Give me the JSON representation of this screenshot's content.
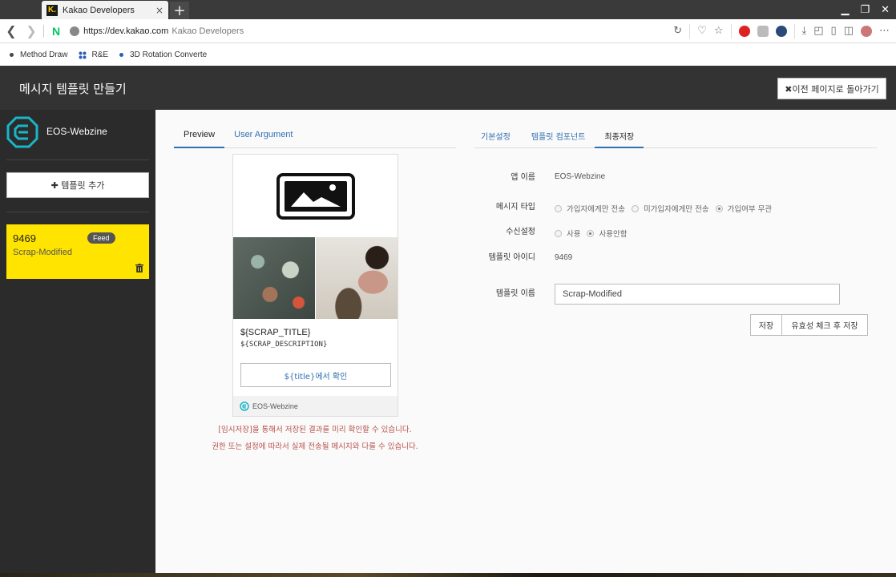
{
  "browser": {
    "tab_favicon": "K.",
    "tab_title": "Kakao Developers",
    "tab_close": "×",
    "new_tab": "+",
    "naver_logo": "N",
    "url": "https://dev.kakao.com",
    "site_name": "Kakao Developers",
    "bookmarks": [
      {
        "label": "Method Draw"
      },
      {
        "label": "R&E"
      },
      {
        "label": "3D Rotation Converte"
      }
    ]
  },
  "header": {
    "title": "메시지 템플릿 만들기",
    "back_label": "✖이전 페이지로 돌아가기"
  },
  "sidebar": {
    "app_name": "EOS-Webzine",
    "add_template_label": "✚ 템플릿 추가",
    "templates": [
      {
        "id": "9469",
        "name": "Scrap-Modified",
        "badge": "Feed"
      }
    ]
  },
  "preview_tabs": [
    {
      "label": "Preview",
      "active": true
    },
    {
      "label": "User Argument",
      "active": false
    }
  ],
  "settings_tabs": [
    {
      "label": "기본설정",
      "active": false
    },
    {
      "label": "템플릿 컴포넌트",
      "active": false
    },
    {
      "label": "최종저장",
      "active": true
    }
  ],
  "preview": {
    "title": "${SCRAP_TITLE}",
    "description": "${SCRAP_DESCRIPTION}",
    "button_label": "${title}에서 확인",
    "footer_app": "EOS-Webzine"
  },
  "notices": [
    "[임시저장]을 통해서 저장된 결과를 미리 확인할 수 있습니다.",
    "권한 또는 설정에 따라서 실제 전송될 메시지와 다를 수 있습니다."
  ],
  "form": {
    "app_name_label": "앱 이름",
    "app_name_value": "EOS-Webzine",
    "message_type_label": "메시지 타입",
    "message_type_options": [
      "가입자에게만 전송",
      "미가입자에게만 전송",
      "가입여부 무관"
    ],
    "message_type_selected": 2,
    "receive_label": "수신설정",
    "receive_options": [
      "사용",
      "사용안함"
    ],
    "receive_selected": 1,
    "template_id_label": "템플릿 아이디",
    "template_id_value": "9469",
    "template_name_label": "템플릿 이름",
    "template_name_value": "Scrap-Modified",
    "save_label": "저장",
    "validate_save_label": "유효성 체크 후 저장"
  },
  "colors": {
    "header_bg": "#333333",
    "sidebar_bg": "#2b2b2b",
    "template_card": "#ffe400",
    "link_blue": "#2f6fb3",
    "notice_red": "#b8514a",
    "logo_teal": "#19b6c8"
  }
}
